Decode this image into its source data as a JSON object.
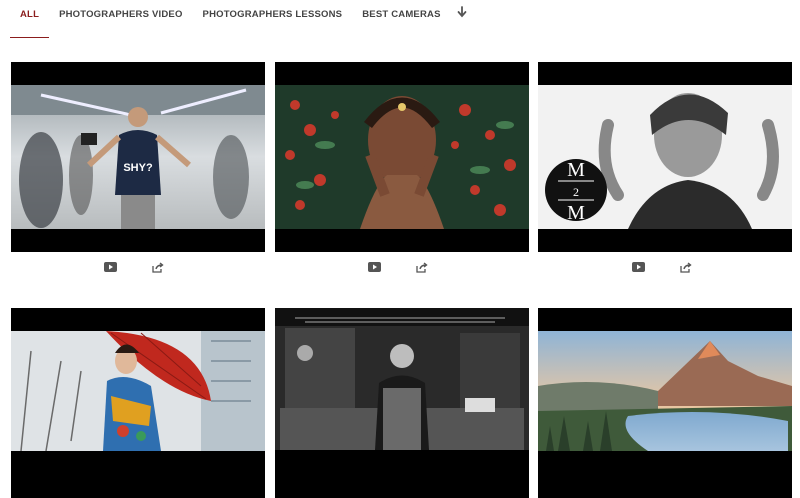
{
  "tabs": [
    {
      "label": "ALL",
      "active": true
    },
    {
      "label": "PHOTOGRAPHERS VIDEO",
      "active": false
    },
    {
      "label": "PHOTOGRAPHERS LESSONS",
      "active": false
    },
    {
      "label": "BEST CAMERAS",
      "active": false
    }
  ],
  "icons": {
    "more": "arrow-down-icon",
    "video": "youtube-play-icon",
    "share": "share-icon"
  },
  "cards": [
    {
      "subject": "man in subway corridor",
      "shirt_text": "SHY?"
    },
    {
      "subject": "woman with red berries"
    },
    {
      "subject": "portrait with logo",
      "logo_text": {
        "top": "M",
        "middle": "2",
        "bottom": "M"
      }
    },
    {
      "subject": "woman with red umbrella"
    },
    {
      "subject": "chef in kitchen"
    },
    {
      "subject": "mountain lake sunset"
    }
  ],
  "colors": {
    "accent": "#8b1d1d",
    "tab_text": "#444444",
    "icon": "#555555"
  }
}
